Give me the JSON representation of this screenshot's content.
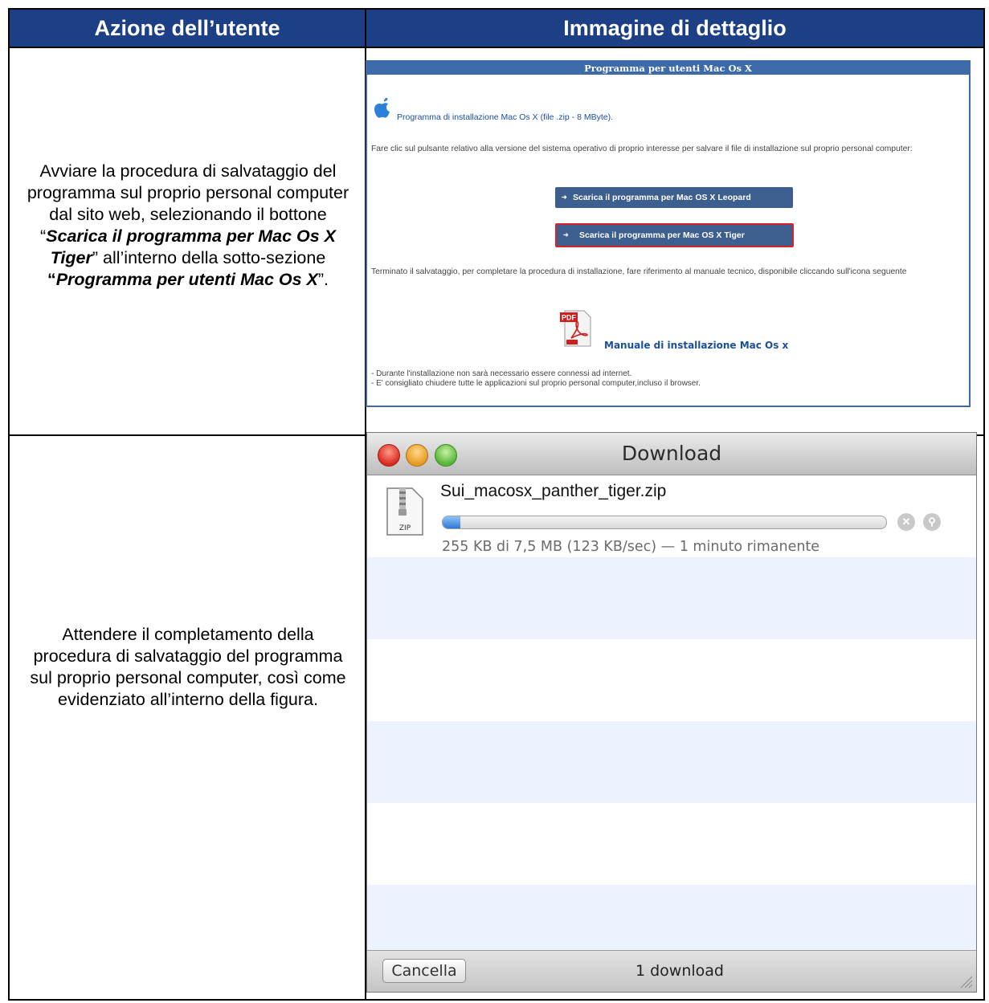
{
  "table": {
    "header_left": "Azione dell’utente",
    "header_right": "Immagine di dettaglio"
  },
  "row1": {
    "action": {
      "t1": "Avviare la procedura di salvataggio del programma sul proprio personal computer dal sito web, selezionando il bottone “",
      "b1": "Scarica il programma per Mac Os X Tiger",
      "t2": "” all’interno della sotto-sezione ",
      "b2_quote": "“",
      "b2": "Programma per utenti Mac Os X",
      "t3": "”."
    },
    "web": {
      "section_title": "Programma per utenti Mac Os X",
      "installer_link": "Programma di installazione Mac Os X (file .zip - 8 MByte).",
      "intro": "Fare clic sul pulsante relativo alla versione del sistema operativo di proprio interesse per salvare il file di installazione sul proprio personal computer:",
      "btn_leopard": "Scarica il programma per Mac OS X Leopard",
      "btn_tiger": "Scarica il programma per Mac OS X Tiger",
      "after": "Terminato il salvataggio, per completare la procedura di installazione, fare riferimento al manuale tecnico, disponibile cliccando sull'icona seguente",
      "pdf_label": "PDF",
      "manual_link": "Manuale di installazione Mac Os x",
      "note1": "- Durante l'installazione non sarà necessario essere connessi ad internet.",
      "note2": "- E' consigliato chiudere tutte le applicazioni sul proprio personal computer,incluso il browser."
    }
  },
  "row2": {
    "action": "Attendere il completamento della procedura di salvataggio del programma sul proprio personal computer, così come evidenziato all’interno della figura.",
    "window": {
      "title": "Download",
      "file_name": "Sui_macosx_panther_tiger.zip",
      "zip_label": "ZIP",
      "progress": 0.04,
      "status": "255 KB di 7,5 MB (123 KB/sec) — 1 minuto rimanente",
      "clear_button": "Cancella",
      "count": "1 download"
    }
  },
  "colors": {
    "header_bg": "#1c3f86",
    "web_accent": "#3d6aa8",
    "button_bg": "#3d5f8f",
    "highlight": "#d6232a",
    "stripe": "#edf3fe"
  }
}
